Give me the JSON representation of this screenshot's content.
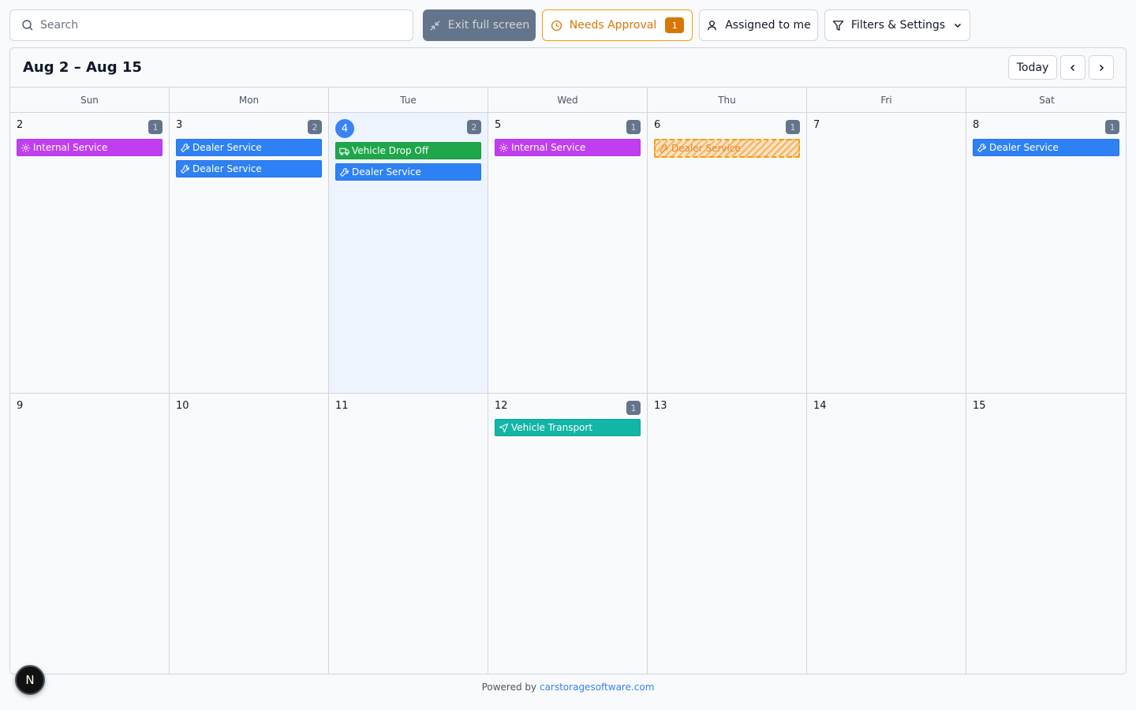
{
  "toolbar": {
    "search_placeholder": "Search",
    "exit_fullscreen_label": "Exit full screen",
    "needs_approval_label": "Needs Approval",
    "needs_approval_count": "1",
    "assigned_label": "Assigned to me",
    "filters_label": "Filters & Settings"
  },
  "calendar": {
    "range_title": "Aug 2 – Aug 15",
    "today_label": "Today",
    "weekdays": [
      "Sun",
      "Mon",
      "Tue",
      "Wed",
      "Thu",
      "Fri",
      "Sat"
    ],
    "week1": [
      {
        "num": "2",
        "count": "1",
        "events": [
          {
            "label": "Internal Service"
          }
        ]
      },
      {
        "num": "3",
        "count": "2",
        "events": [
          {
            "label": "Dealer Service"
          },
          {
            "label": "Dealer Service"
          }
        ]
      },
      {
        "num": "4",
        "count": "2",
        "events": [
          {
            "label": "Vehicle Drop Off"
          },
          {
            "label": "Dealer Service"
          }
        ]
      },
      {
        "num": "5",
        "count": "1",
        "events": [
          {
            "label": "Internal Service"
          }
        ]
      },
      {
        "num": "6",
        "count": "1",
        "events": [
          {
            "label": "Dealer Service"
          }
        ]
      },
      {
        "num": "7"
      },
      {
        "num": "8",
        "count": "1",
        "events": [
          {
            "label": "Dealer Service"
          }
        ]
      }
    ],
    "week2": [
      {
        "num": "9"
      },
      {
        "num": "10"
      },
      {
        "num": "11"
      },
      {
        "num": "12",
        "count": "1",
        "events": [
          {
            "label": "Vehicle Transport"
          }
        ]
      },
      {
        "num": "13"
      },
      {
        "num": "14"
      },
      {
        "num": "15"
      }
    ]
  },
  "footer": {
    "prefix": "Powered by",
    "link": "carstoragesoftware.com"
  },
  "avatar_letter": "N",
  "colors": {
    "internal_service": "#c03ef0",
    "dealer_service": "#2e81f4",
    "vehicle_drop_off": "#1fa64a",
    "vehicle_transport": "#12b5a6",
    "pending": "#f59e0b",
    "today_highlight": "#3b82f6"
  }
}
